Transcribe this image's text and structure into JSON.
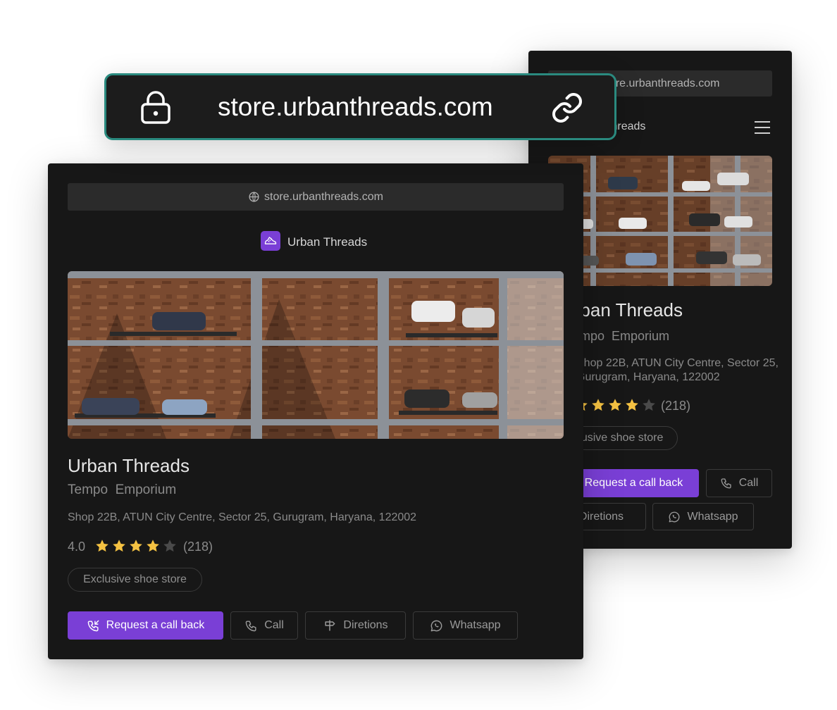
{
  "hero_bar": {
    "url": "store.urbanthreads.com",
    "lock_icon": "lock-icon",
    "link_icon": "link-icon"
  },
  "back_card": {
    "url": "store.urbanthreads.com",
    "header_title": "Urban Threads",
    "title": "Urban Threads",
    "subtitle": "Tempo  Emporium",
    "address_line1": "Shop 22B, ATUN City Centre, Sector 25,",
    "address_line2": "Gurugram, Haryana, 122002",
    "review_count": "(218)",
    "tag": "Exclusive shoe store",
    "buttons": {
      "request": "Request a call back",
      "call": "Call",
      "directions": "Diretions",
      "whatsapp": "Whatsapp"
    }
  },
  "front_card": {
    "url": "store.urbanthreads.com",
    "brand_name": "Urban Threads",
    "title": "Urban Threads",
    "subtitle": "Tempo  Emporium",
    "address": "Shop 22B, ATUN City Centre, Sector 25, Gurugram, Haryana, 122002",
    "rating": "4.0",
    "rating_value": 4,
    "rating_max": 5,
    "review_count": "(218)",
    "tag": "Exclusive shoe store",
    "buttons": {
      "request": "Request a call back",
      "call": "Call",
      "directions": "Diretions",
      "whatsapp": "Whatsapp"
    }
  },
  "colors": {
    "accent": "#7a3fd6",
    "hero_border": "#2a8a7f",
    "card_bg": "#171717",
    "star": "#f5c242",
    "star_empty": "#4a4a4a"
  }
}
